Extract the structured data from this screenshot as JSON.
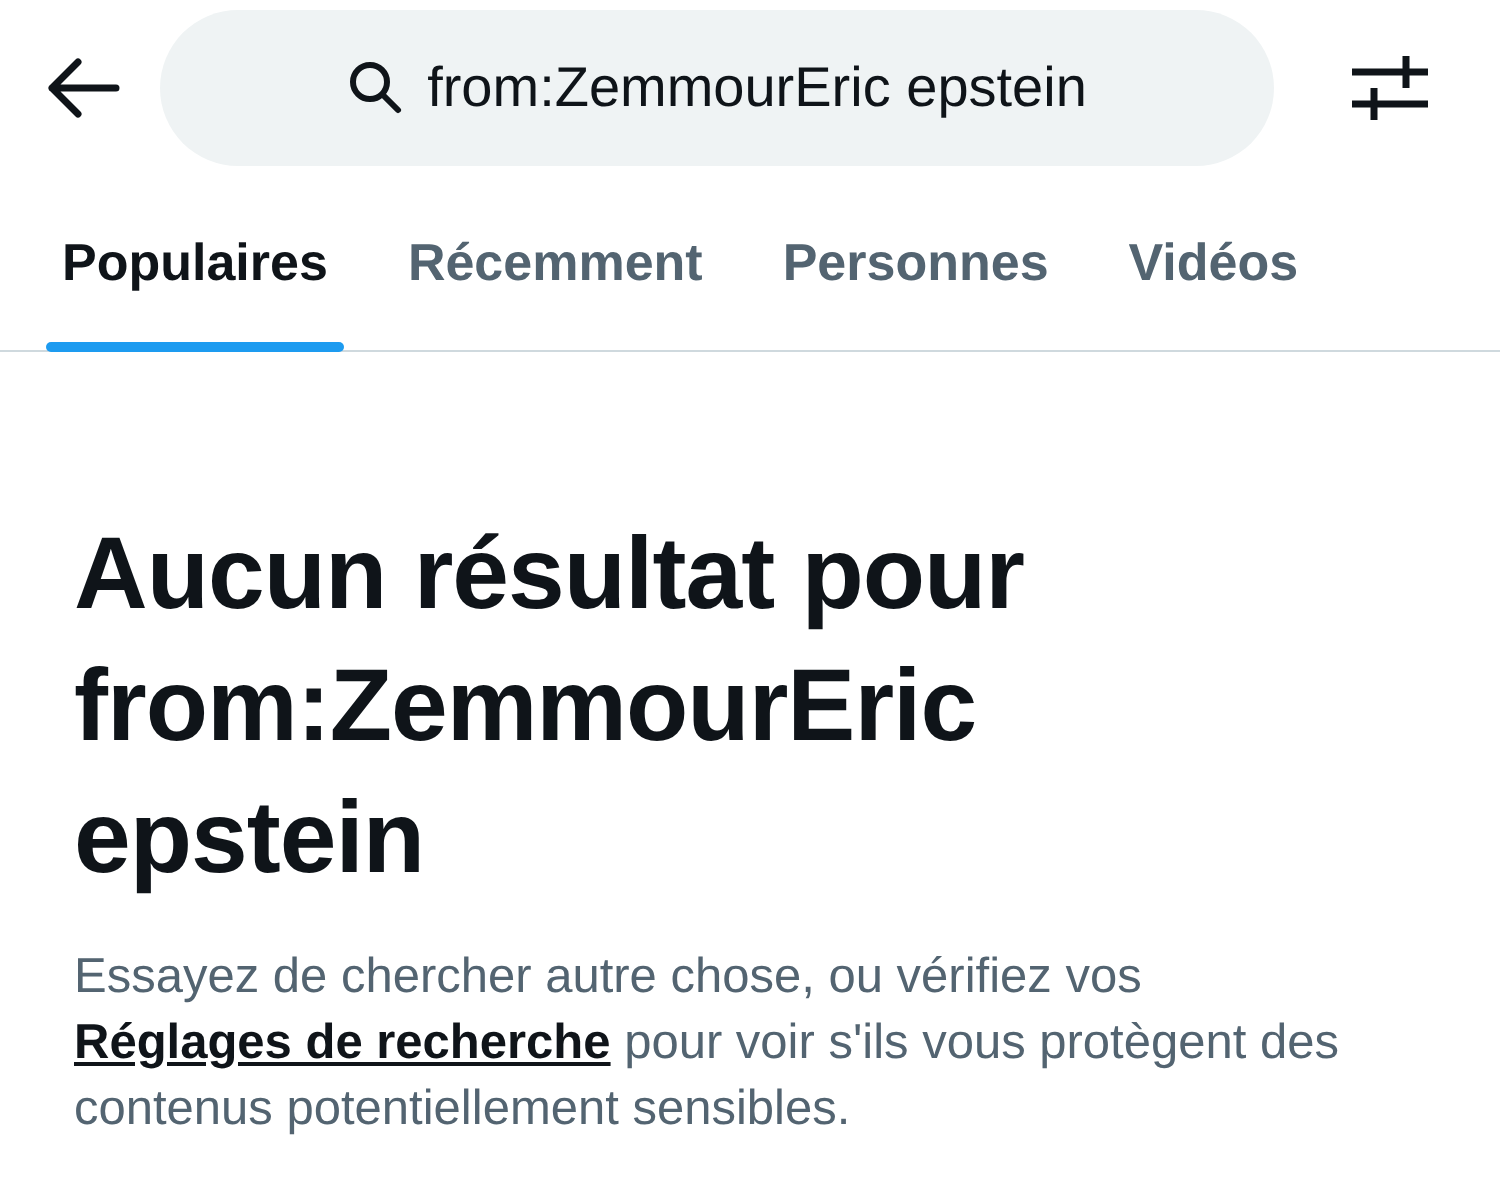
{
  "search": {
    "value": "from:ZemmourEric epstein"
  },
  "tabs": [
    {
      "label": "Populaires",
      "selected": true
    },
    {
      "label": "Récemment",
      "selected": false
    },
    {
      "label": "Personnes",
      "selected": false
    },
    {
      "label": "Vidéos",
      "selected": false
    }
  ],
  "empty_state": {
    "title": "Aucun résultat pour from:ZemmourEric epstein",
    "message_before": "Essayez de chercher autre chose, ou vérifiez vos ",
    "link": "Réglages de recherche",
    "message_after": " pour voir s'ils vous protègent des contenus potentiellement sensibles."
  }
}
